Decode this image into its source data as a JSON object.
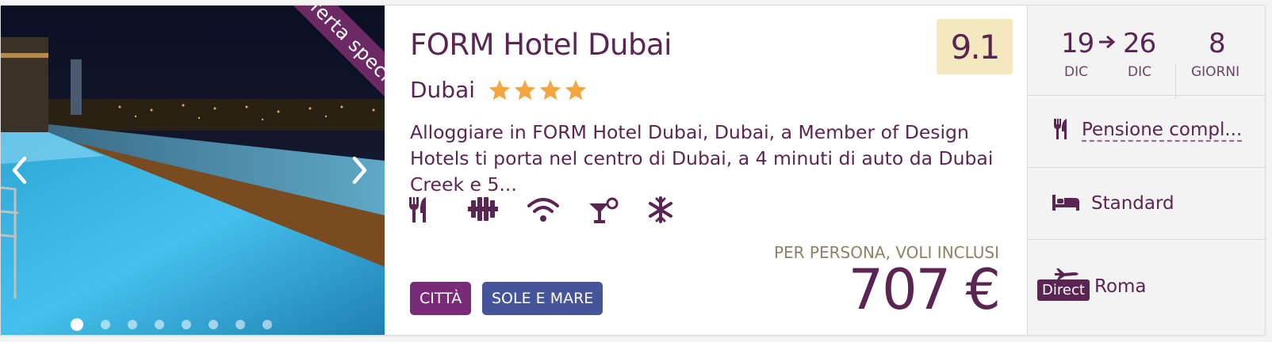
{
  "photo": {
    "ribbon": "Offerta speciale",
    "slides_total": 8,
    "active_slide": 1
  },
  "hotel": {
    "name": "FORM Hotel Dubai",
    "city": "Dubai",
    "stars": 4,
    "score": "9.1",
    "description": "Alloggiare in FORM Hotel Dubai, Dubai, a Member of Design Hotels ti porta nel centro di Dubai, a 4 minuti di auto da Dubai Creek e 5..."
  },
  "amenities": [
    "restaurant-icon",
    "gym-icon",
    "wifi-icon",
    "bar-icon",
    "air-conditioning-icon"
  ],
  "tags": {
    "city": "CITTÀ",
    "beach": "SOLE E MARE"
  },
  "price": {
    "label": "PER PERSONA, VOLI INCLUSI",
    "value": "707 €"
  },
  "trip": {
    "from_day": "19",
    "from_month": "DIC",
    "to_day": "26",
    "to_month": "DIC",
    "days": "8",
    "days_label": "GIORNI",
    "board": "Pensione compl...",
    "room": "Standard",
    "flight_badge": "Direct",
    "departure": "Roma"
  },
  "colors": {
    "brand": "#5a2552",
    "score_bg": "#f4e8c1",
    "star": "#f2a540",
    "tag_city": "#7a2b78",
    "tag_beach": "#46549a"
  }
}
